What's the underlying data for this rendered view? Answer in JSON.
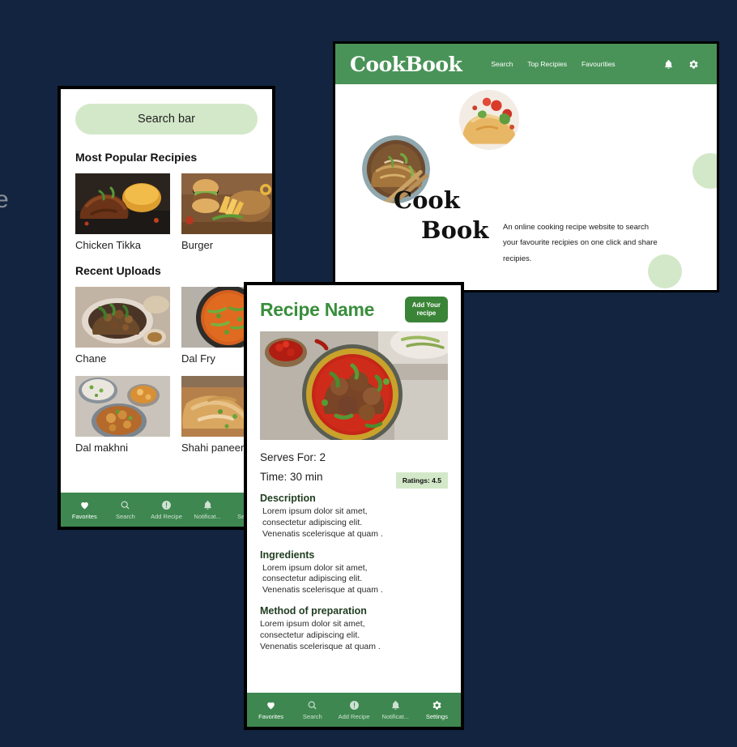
{
  "canvas": {
    "background_color": "#12243F",
    "edge_letter": "e"
  },
  "theme": {
    "header_green": "#4A9358",
    "nav_green": "#3E8750",
    "button_green": "#3A8438",
    "light_green": "#D3E8C8",
    "title_green": "#3A8E3C",
    "heading_green": "#1F3D20"
  },
  "desktop": {
    "logo": "CookBook",
    "nav": [
      {
        "label": "Search",
        "icon": ""
      },
      {
        "label": "Top Recipies",
        "icon": ""
      },
      {
        "label": "Favourities",
        "icon": ""
      }
    ],
    "icons": [
      {
        "name": "bell-icon"
      },
      {
        "name": "gear-icon"
      }
    ],
    "hero": {
      "logotype_line1": "Cook",
      "logotype_line2": "Book",
      "tagline": "An online cooking recipe website to search your favourite recipies on one click and share recipies."
    }
  },
  "home": {
    "search_placeholder": "Search bar",
    "sections": [
      {
        "title": "Most Popular Recipies",
        "items": [
          {
            "label": "Chicken Tikka"
          },
          {
            "label": "Burger"
          }
        ]
      },
      {
        "title": "Recent Uploads",
        "items": [
          {
            "label": "Chane"
          },
          {
            "label": "Dal Fry"
          },
          {
            "label": "Dal makhni"
          },
          {
            "label": "Shahi paneer"
          }
        ]
      }
    ],
    "bottom_nav": [
      {
        "label": "Favorites",
        "icon": "heart-icon",
        "active": true
      },
      {
        "label": "Search",
        "icon": "search-icon",
        "active": false
      },
      {
        "label": "Add Recipe",
        "icon": "add-circle-icon",
        "active": false
      },
      {
        "label": "Notificat...",
        "icon": "bell-icon",
        "active": false
      },
      {
        "label": "Settings",
        "icon": "gear-icon",
        "active": false
      }
    ]
  },
  "detail": {
    "title": "Recipe Name",
    "add_button": "Add Your\nrecipe",
    "serves": "Serves For: 2",
    "time": "Time: 30 min",
    "rating": "Ratings: 4.5",
    "sections": [
      {
        "heading": "Description",
        "body": "Lorem ipsum dolor sit amet,\nconsectetur adipiscing elit.\nVenenatis scelerisque at quam ."
      },
      {
        "heading": "Ingredients",
        "body": "Lorem ipsum dolor sit amet,\nconsectetur adipiscing elit.\nVenenatis scelerisque at quam ."
      },
      {
        "heading": "Method of preparation",
        "body": "Lorem ipsum dolor sit amet,\nconsectetur adipiscing elit.\nVenenatis scelerisque at quam ."
      }
    ],
    "bottom_nav": [
      {
        "label": "Favorites",
        "icon": "heart-icon",
        "active": true
      },
      {
        "label": "Search",
        "icon": "search-icon",
        "active": false
      },
      {
        "label": "Add Recipe",
        "icon": "add-circle-icon",
        "active": false
      },
      {
        "label": "Notificat...",
        "icon": "bell-icon",
        "active": false
      },
      {
        "label": "Settings",
        "icon": "gear-icon",
        "active": true
      }
    ]
  }
}
